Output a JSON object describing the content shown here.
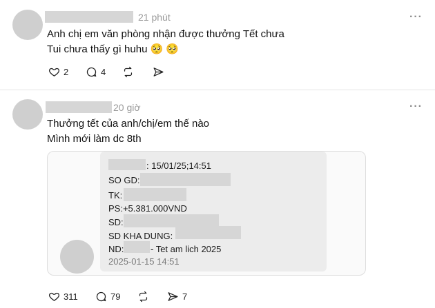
{
  "posts": [
    {
      "time": "21 phút",
      "more": "···",
      "lines": [
        "Anh chị em văn phòng nhận được thưởng Tết chưa",
        "Tui chưa thấy gì huhu 🥺 🥺"
      ],
      "actions": {
        "likes": "2",
        "comments": "4"
      }
    },
    {
      "time": "20 giờ",
      "more": "···",
      "lines": [
        "Thưởng tết của anh/chị/em thế nào",
        "Mình mới làm dc 8th"
      ],
      "actions": {
        "likes": "311",
        "comments": "79",
        "shares": "7"
      },
      "receipt": {
        "line1": ": 15/01/25;14:51",
        "so_gd_label": "SO GD:",
        "tk_label": "TK:",
        "ps": "PS:+5.381.000VND",
        "sd_label": "SD:",
        "sd_kha_dung_label": "SD KHA DUNG:",
        "nd_label": "ND:",
        "nd_text": "- Tet am lich 2025",
        "timestamp": "2025-01-15 14:51"
      }
    }
  ],
  "colors": {
    "avatar": "#cfcfcf",
    "redaction": "#d6d6d6",
    "muted": "#9a9a9a"
  },
  "icons": [
    "heart-icon",
    "comment-icon",
    "repost-icon",
    "send-icon"
  ]
}
